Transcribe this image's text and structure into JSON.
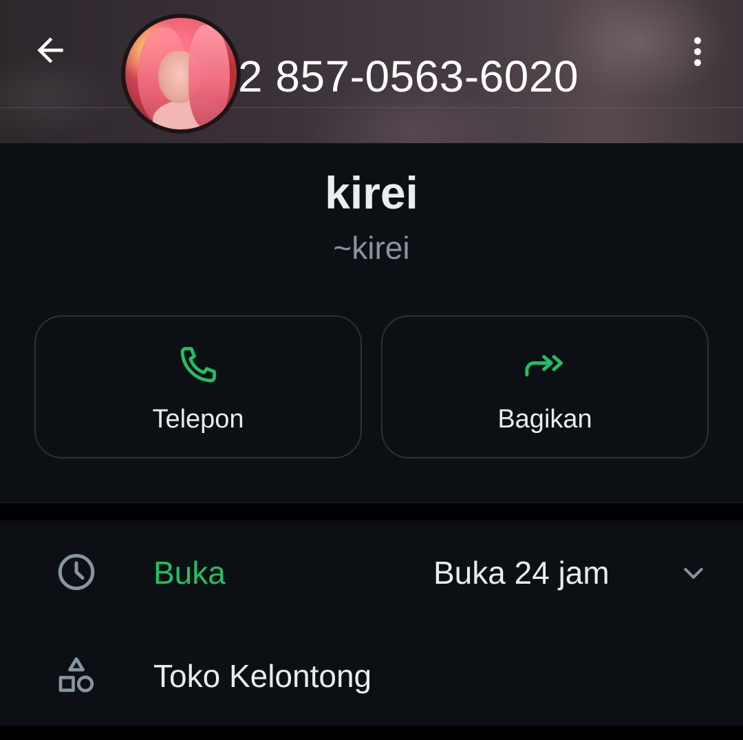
{
  "header": {
    "phone_number": "2 857-0563-6020",
    "back_icon": "arrow-left-icon",
    "menu_icon": "more-vertical-icon",
    "avatar_alt": "profile photo"
  },
  "profile": {
    "name": "kirei",
    "username": "~kirei"
  },
  "actions": [
    {
      "label": "Telepon",
      "icon": "phone-icon"
    },
    {
      "label": "Bagikan",
      "icon": "share-forward-icon"
    }
  ],
  "business": {
    "hours": {
      "status": "Buka",
      "detail": "Buka 24 jam",
      "icon": "clock-icon",
      "expand_icon": "chevron-down-icon"
    },
    "category": {
      "label": "Toko Kelontong",
      "icon": "shapes-icon"
    }
  },
  "colors": {
    "accent_green": "#21c063",
    "background": "#0c1014",
    "text_primary": "#e9edef",
    "text_secondary": "#8696a0"
  }
}
